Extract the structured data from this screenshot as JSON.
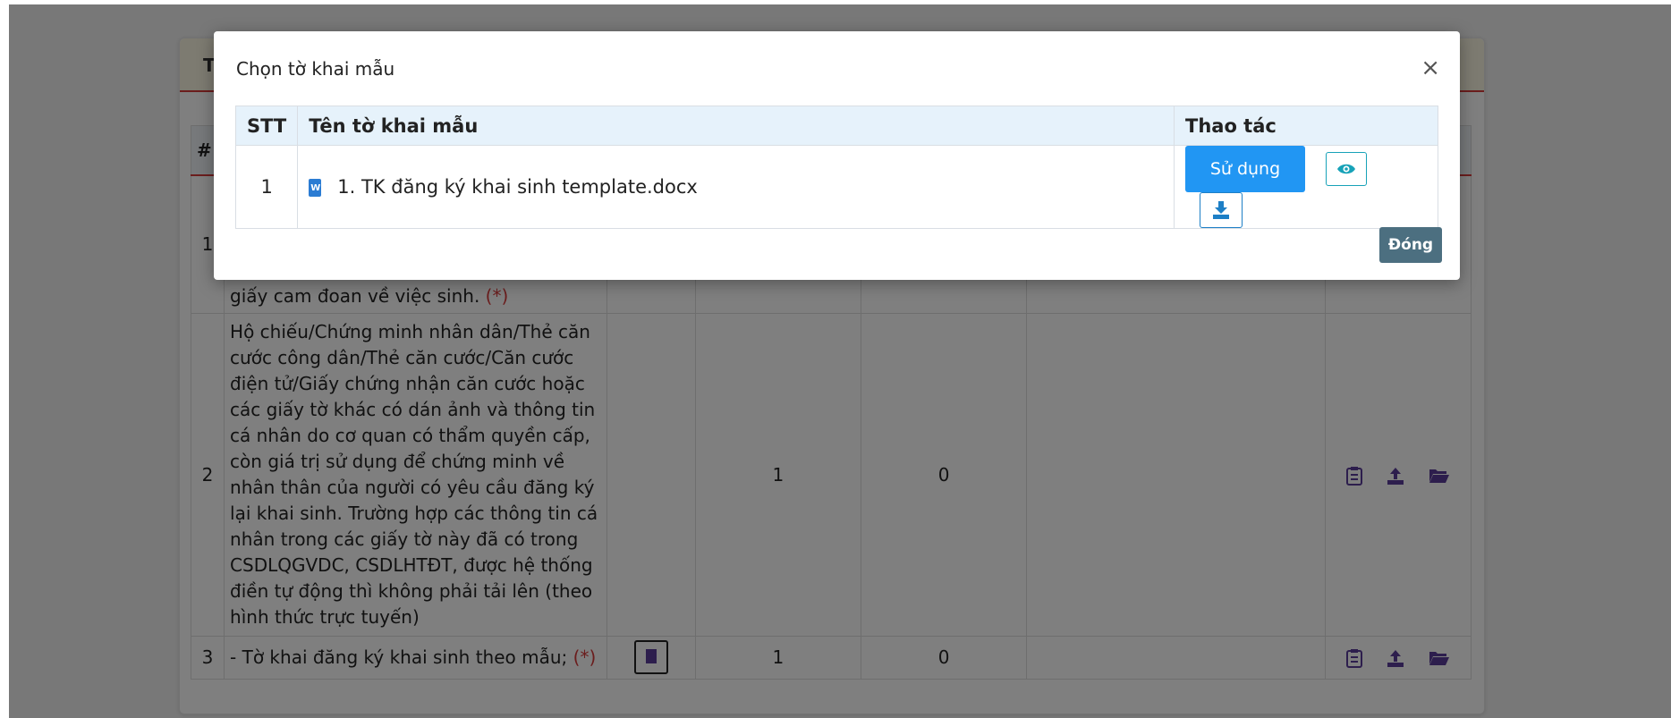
{
  "page": {
    "card_header_title": "T",
    "table": {
      "headers": [
        "#",
        "",
        "",
        "",
        "",
        "",
        ""
      ],
      "rows": [
        {
          "num": "1",
          "name": "giấy cam đoan về việc sinh.",
          "required": "(*)",
          "count_a": "",
          "count_b": ""
        },
        {
          "num": "2",
          "name": "Hộ chiếu/Chứng minh nhân dân/Thẻ căn cước công dân/Thẻ căn cước/Căn cước điện tử/Giấy chứng nhận căn cước hoặc các giấy tờ khác có dán ảnh và thông tin cá nhân do cơ quan có thẩm quyền cấp, còn giá trị sử dụng để chứng minh về nhân thân của người có yêu cầu đăng ký lại khai sinh. Trường hợp các thông tin cá nhân trong các giấy tờ này đã có trong CSDLQGVDC, CSDLHTĐT, được hệ thống điền tự động thì không phải tải lên (theo hình thức trực tuyến)",
          "required": "",
          "count_a": "1",
          "count_b": "0"
        },
        {
          "num": "3",
          "name": "- Tờ khai đăng ký khai sinh theo mẫu;",
          "required": "(*)",
          "count_a": "1",
          "count_b": "0"
        }
      ]
    }
  },
  "modal": {
    "title": "Chọn tờ khai mẫu",
    "close_symbol": "×",
    "table": {
      "headers": {
        "stt": "STT",
        "name": "Tên tờ khai mẫu",
        "actions": "Thao tác"
      },
      "rows": [
        {
          "stt": "1",
          "file_icon": "word-file-icon",
          "file_icon_letter": "W",
          "name": "1. TK đăng ký khai sinh template.docx",
          "use_label": "Sử dụng",
          "view_icon": "eye-icon",
          "download_icon": "download-icon"
        }
      ]
    },
    "close_button": "Đóng"
  },
  "colors": {
    "primary": "#2196f3",
    "close_button": "#4c6f80",
    "header_accent": "#d63a3a",
    "icon_purple": "#5a3c9a",
    "modal_header_bg": "#e6f2fb"
  }
}
